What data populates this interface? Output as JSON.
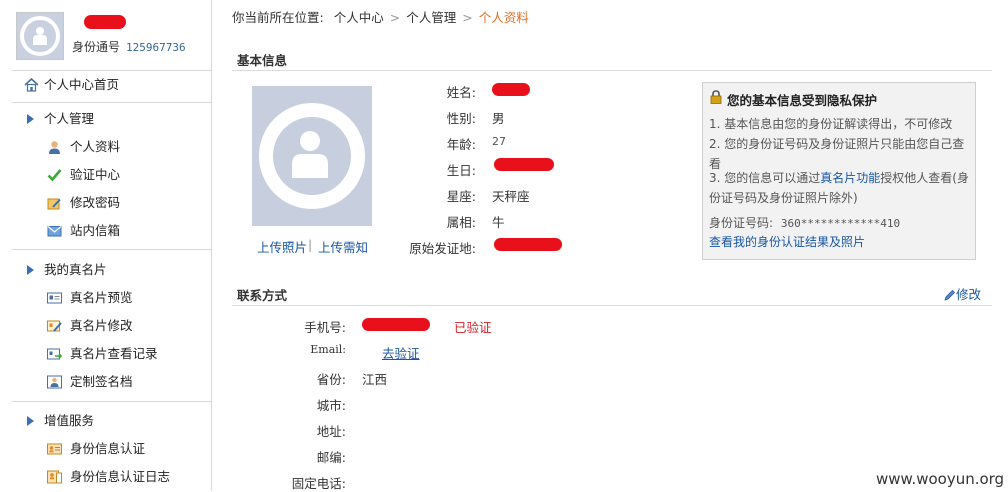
{
  "profile": {
    "id_label": "身份通号",
    "id_number": "125967736"
  },
  "sidebar": {
    "home": "个人中心首页",
    "groups": [
      {
        "title": "个人管理",
        "items": [
          "个人资料",
          "验证中心",
          "修改密码",
          "站内信箱"
        ]
      },
      {
        "title": "我的真名片",
        "items": [
          "真名片预览",
          "真名片修改",
          "真名片查看记录",
          "定制签名档"
        ]
      },
      {
        "title": "增值服务",
        "items": [
          "身份信息认证",
          "身份信息认证日志"
        ]
      }
    ]
  },
  "breadcrumb": {
    "prefix": "你当前所在位置:",
    "items": [
      "个人中心",
      "个人管理"
    ],
    "current": "个人资料"
  },
  "basic_info": {
    "title": "基本信息",
    "upload_photo": "上传照片",
    "divider": "|",
    "upload_notice": "上传需知",
    "fields": {
      "name_label": "姓名:",
      "gender_label": "性别:",
      "gender": "男",
      "age_label": "年龄:",
      "age": "27",
      "birthday_label": "生日:",
      "constellation_label": "星座:",
      "constellation": "天秤座",
      "zodiac_label": "属相:",
      "zodiac": "牛",
      "origin_label": "原始发证地:"
    }
  },
  "privacy": {
    "title": "您的基本信息受到隐私保护",
    "line1": "1. 基本信息由您的身份证解读得出，不可修改",
    "line2": "2. 您的身份证号码及身份证照片只能由您自己查看",
    "line3_pre": "3. 您的信息可以通过",
    "line3_link": "真名片功能",
    "line3_post": "授权他人查看(身份证号码及身份证照片除外)",
    "id_label": "身份证号码:",
    "id_value": "360************410",
    "view_link": "查看我的身份认证结果及照片"
  },
  "contact": {
    "title": "联系方式",
    "edit": "修改",
    "phone_label": "手机号:",
    "phone_status": "已验证",
    "email_label": "Email:",
    "email_action": "去验证",
    "province_label": "省份:",
    "province": "江西",
    "city_label": "城市:",
    "address_label": "地址:",
    "zip_label": "邮编:",
    "tel_label": "固定电话:"
  },
  "watermark": "www.wooyun.org"
}
